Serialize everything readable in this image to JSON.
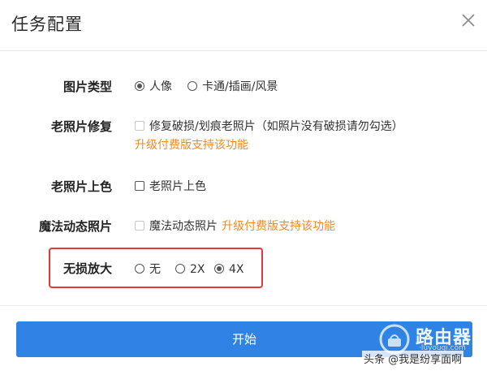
{
  "dialog": {
    "title": "任务配置"
  },
  "rows": {
    "image_type": {
      "label": "图片类型",
      "options": [
        "人像",
        "卡通/插画/风景"
      ],
      "selected": "人像"
    },
    "old_photo_repair": {
      "label": "老照片修复",
      "option": "修复破损/划痕老照片（如照片没有破损请勿勾选）",
      "upsell": "升级付费版支持该功能"
    },
    "old_photo_color": {
      "label": "老照片上色",
      "option": "老照片上色"
    },
    "magic_motion": {
      "label": "魔法动态照片",
      "option": "魔法动态照片",
      "upsell": "升级付费版支持该功能"
    },
    "lossless_zoom": {
      "label": "无损放大",
      "options": [
        "无",
        "2X",
        "4X"
      ],
      "selected": "4X"
    }
  },
  "footer": {
    "start_label": "开始"
  },
  "watermark": {
    "brand": "路由器",
    "sub": "·luyouqi.com",
    "attribution": "头条 @我是纷享面啊"
  },
  "colors": {
    "accent": "#2f83e4",
    "upsell": "#f08a24",
    "highlight": "#e53935"
  }
}
